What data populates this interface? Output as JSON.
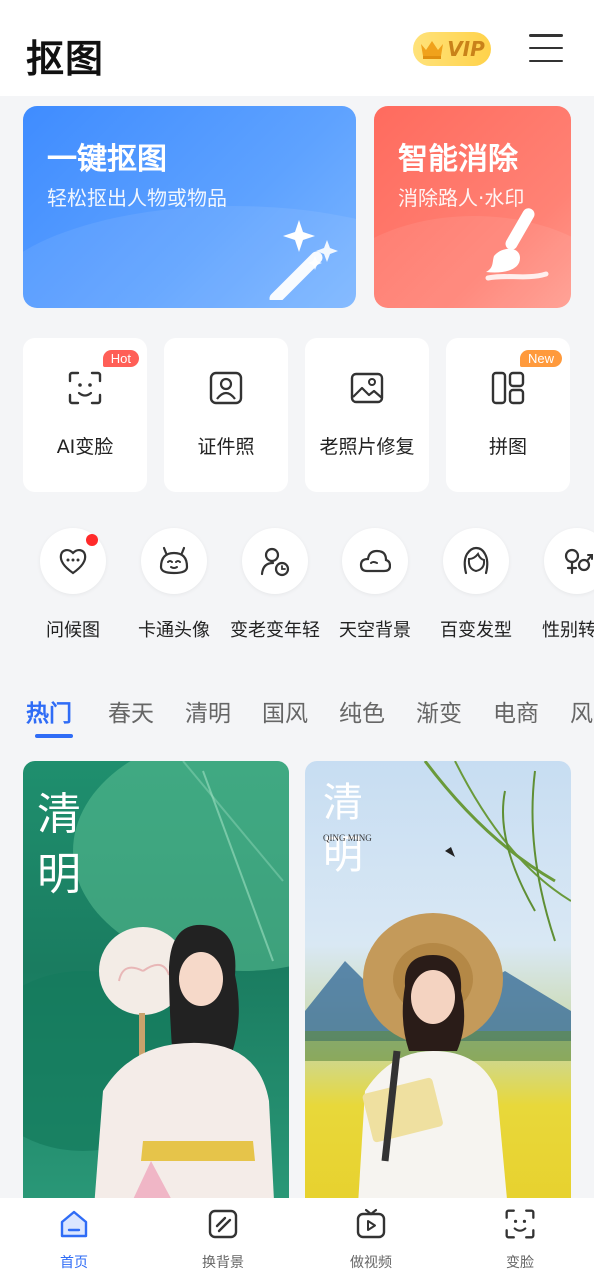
{
  "header": {
    "logo": "抠图",
    "vip_label": "VIP",
    "icons": {
      "vip": "crown-icon",
      "menu": "menu-icon"
    }
  },
  "big_cards": [
    {
      "title": "一键抠图",
      "subtitle": "轻松抠出人物或物品",
      "icon": "magic-wand-icon",
      "color": "#4a93ff"
    },
    {
      "title": "智能消除",
      "subtitle": "消除路人·水印",
      "icon": "brush-icon",
      "color": "#ff7468"
    }
  ],
  "features": [
    {
      "label": "AI变脸",
      "icon": "face-scan-icon",
      "badge": "Hot"
    },
    {
      "label": "证件照",
      "icon": "id-photo-icon"
    },
    {
      "label": "老照片修复",
      "icon": "image-icon"
    },
    {
      "label": "拼图",
      "icon": "collage-icon",
      "badge": "New"
    }
  ],
  "tools": [
    {
      "label": "问候图",
      "icon": "heart-chat-icon",
      "has_dot": true
    },
    {
      "label": "卡通头像",
      "icon": "cartoon-face-icon"
    },
    {
      "label": "变老变年轻",
      "icon": "person-clock-icon"
    },
    {
      "label": "天空背景",
      "icon": "cloud-icon"
    },
    {
      "label": "百变发型",
      "icon": "hairstyle-icon"
    },
    {
      "label": "性别转",
      "icon": "gender-icon"
    }
  ],
  "tabs": [
    "热门",
    "春天",
    "清明",
    "国风",
    "纯色",
    "渐变",
    "电商",
    "风"
  ],
  "active_tab": "热门",
  "photos": [
    {
      "title": "清明",
      "icon": "template-photo"
    },
    {
      "title": "清明",
      "subtitle": "QING MING",
      "icon": "template-photo"
    }
  ],
  "bottom_nav": [
    {
      "label": "首页",
      "icon": "home-icon",
      "active": true
    },
    {
      "label": "换背景",
      "icon": "background-swap-icon"
    },
    {
      "label": "做视频",
      "icon": "video-icon"
    },
    {
      "label": "变脸",
      "icon": "face-scan-icon"
    }
  ],
  "colors": {
    "accent": "#2f6cf6",
    "hot_badge": "#ff5f57",
    "new_badge": "#ff9a3c",
    "vip": "#ffd24a"
  }
}
